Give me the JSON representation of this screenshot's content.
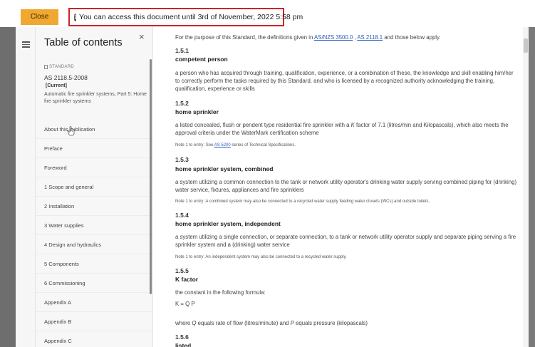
{
  "topbar": {
    "close_label": "Close",
    "notice": "You can access this document until 3rd of November, 2022 5:58 pm"
  },
  "toc": {
    "title": "Table of contents",
    "badge": "STANDARD",
    "code": "AS 2118.5-2008",
    "status": "[Current]",
    "description": "Automatic fire sprinkler systems, Part 5: Home fire sprinkler systems",
    "items": [
      {
        "label": "About this publication"
      },
      {
        "label": "Preface"
      },
      {
        "label": "Foreword"
      },
      {
        "label": "1 Scope and general"
      },
      {
        "label": "2 Installation"
      },
      {
        "label": "3 Water supplies"
      },
      {
        "label": "4 Design and hydraulics"
      },
      {
        "label": "5 Components"
      },
      {
        "label": "6 Commissioning"
      },
      {
        "label": "Appendix A"
      },
      {
        "label": "Appendix B"
      },
      {
        "label": "Appendix C"
      }
    ]
  },
  "content": {
    "intro_a": "For the purpose of this Standard, the definitions given in ",
    "intro_link1": "AS/NZS 3500.0",
    "intro_sep": " , ",
    "intro_link2": "AS 2118.1",
    "intro_b": " and those below apply.",
    "s1_num": "1.5.1",
    "s1_term": "competent person",
    "s1_def": "a person who has acquired through training, qualification, experience, or a combination of these, the knowledge and skill enabling him/her to correctly perform the tasks required by this Standard, and who is licensed by a recognized authority acknowledging the training, qualification, experience or skills",
    "s2_num": "1.5.2",
    "s2_term": "home sprinkler",
    "s2_def_a": "a listed concealed, flush or pendent type residential fire sprinkler with a ",
    "s2_def_k": "K",
    "s2_def_b": " factor of 7.1 (litres/min and Kilopascals), which also meets the approval criteria under the WaterMark certification scheme",
    "s2_note_a": "Note 1 to entry: See ",
    "s2_note_link": "AS 5200",
    "s2_note_b": " series of Technical Specifications.",
    "s3_num": "1.5.3",
    "s3_term": "home sprinkler system, combined",
    "s3_def": "a system utilizing a common connection to the tank or network utility operator's drinking water supply serving combined piping for (drinking) water service, fixtures, appliances and fire sprinklers",
    "s3_note": "Note 1 to entry: A combined system may also be connected to a recycled water supply feeding water closets (WCs) and outside toilets.",
    "s4_num": "1.5.4",
    "s4_term": "home sprinkler system, independent",
    "s4_def": "a system utilizing a single connection, or separate connection, to a tank or network utility operator supply and separate piping serving a fire sprinkler system and a (drinking) water service",
    "s4_note": "Note 1 to entry: An independent system may also be connected to a recycled water supply.",
    "s5_num": "1.5.5",
    "s5_term": "K factor",
    "s5_def": "the constant in the following formula:",
    "s5_formula": "K = Q P",
    "s5_where_a": "where ",
    "s5_where_q": "Q",
    "s5_where_b": " equals rate of flow (litres/minute) and ",
    "s5_where_p": "P",
    "s5_where_c": " equals pressure (kilopascals)",
    "s6_num": "1.5.6",
    "s6_term": "listed"
  }
}
